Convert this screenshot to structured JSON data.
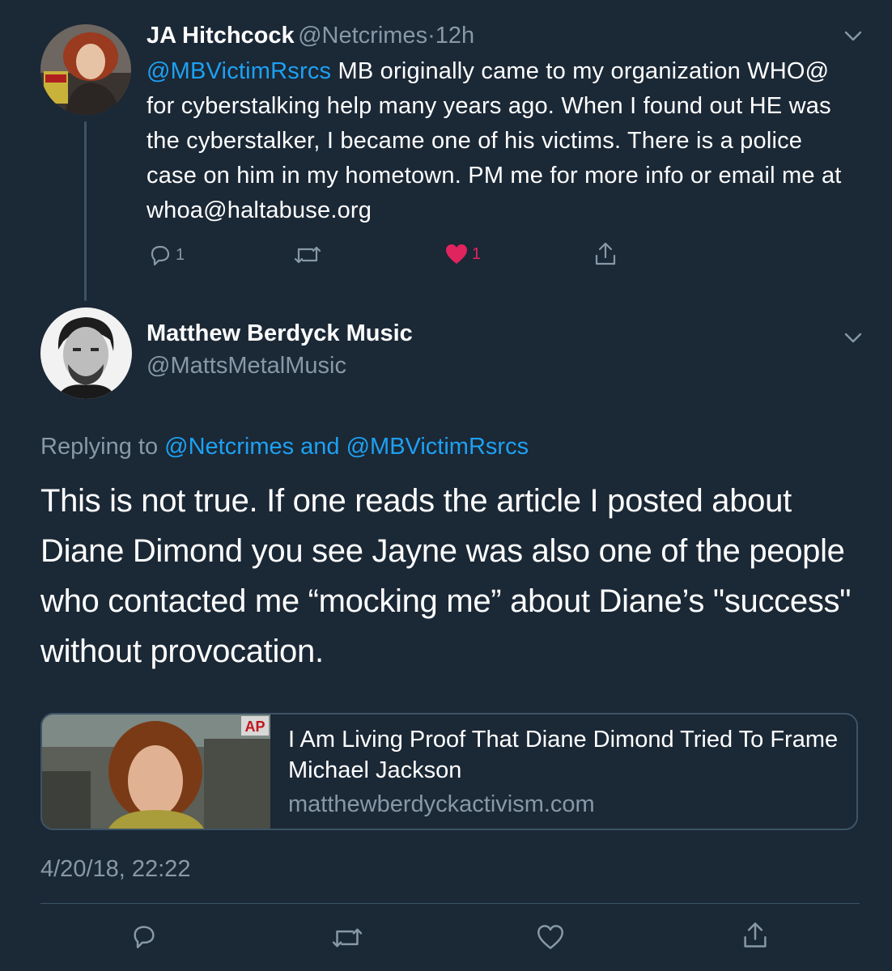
{
  "tweet1": {
    "display_name": "JA Hitchcock",
    "handle": "@Netcrimes",
    "separator": "·",
    "time": "12h",
    "mention": "@MBVictimRsrcs",
    "text": " MB originally came to my organization WHO@ for cyberstalking help many years ago. When I found out HE was the cyberstalker, I became one of his victims. There is a police case on him in my hometown. PM me for  more info or email me at whoa@haltabuse.org",
    "reply_count": "1",
    "like_count": "1",
    "like_color": "#e0245e"
  },
  "tweet2": {
    "display_name": "Matthew Berdyck Music",
    "handle": "@MattsMetalMusic",
    "replying_prefix": "Replying to ",
    "replying_to": "@Netcrimes and @MBVictimRsrcs",
    "text": "This is not true. If one reads the article I posted about Diane Dimond you see Jayne was also one of the people who contacted me “mocking me” about Diane’s \"success\" without provocation.",
    "card": {
      "title": "I Am Living Proof That Diane Dimond Tried To Frame Michael Jackson",
      "domain": "matthewberdyckactivism.com",
      "image_badge": "AP"
    },
    "timestamp": "4/20/18, 22:22"
  },
  "colors": {
    "background": "#1b2836",
    "link": "#1da1f2",
    "secondary_text": "#8899a6",
    "divider": "#3d5466"
  },
  "icons": [
    "chevron-down-icon",
    "reply-icon",
    "retweet-icon",
    "like-icon",
    "share-icon"
  ]
}
